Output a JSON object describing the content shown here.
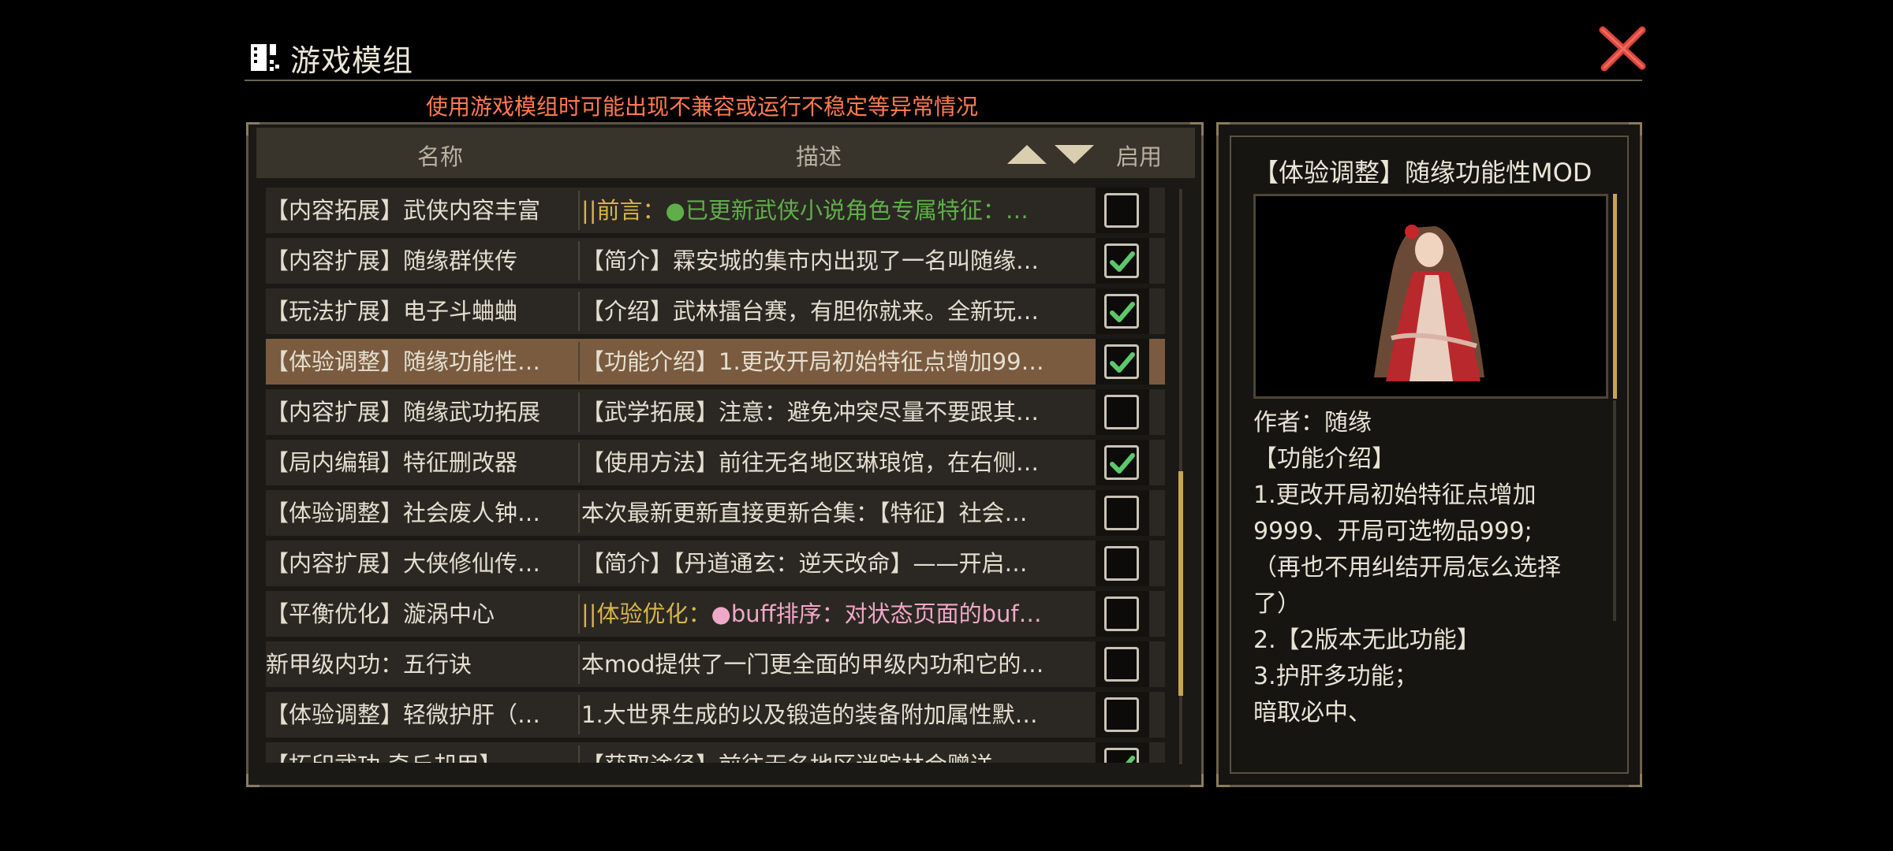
{
  "window": {
    "title": "游戏模组",
    "close_icon": "close-x-icon",
    "header_icon": "mod-grid-icon",
    "warning": "使用游戏模组时可能出现不兼容或运行不稳定等异常情况"
  },
  "table": {
    "columns": {
      "name": "名称",
      "desc": "描述",
      "enable": "启用"
    },
    "sort_icons": [
      "sort-up-icon",
      "sort-down-icon"
    ],
    "rows": [
      {
        "name": "【内容拓展】武侠内容丰富",
        "desc_prefix": "||前言：",
        "desc_prefix_color": "#d8b44a",
        "desc": "●已更新武侠小说角色专属特征：…",
        "desc_color": "#5fae4a",
        "checked": false,
        "selected": false
      },
      {
        "name": "【内容扩展】随缘群侠传",
        "desc_prefix": "",
        "desc": "【简介】霖安城的集市内出现了一名叫随缘…",
        "desc_color": "#e4ded0",
        "checked": true,
        "selected": false
      },
      {
        "name": "【玩法扩展】电子斗蛐蛐",
        "desc_prefix": "",
        "desc": "【介绍】武林擂台赛，有胆你就来。全新玩…",
        "desc_color": "#e4ded0",
        "checked": true,
        "selected": false
      },
      {
        "name": "【体验调整】随缘功能性…",
        "desc_prefix": "",
        "desc": "【功能介绍】1.更改开局初始特征点增加99…",
        "desc_color": "#e4ded0",
        "checked": true,
        "selected": true
      },
      {
        "name": "【内容扩展】随缘武功拓展",
        "desc_prefix": "",
        "desc": "【武学拓展】注意：避免冲突尽量不要跟其…",
        "desc_color": "#e4ded0",
        "checked": false,
        "selected": false
      },
      {
        "name": "【局内编辑】特征删改器",
        "desc_prefix": "",
        "desc": "【使用方法】前往无名地区琳琅馆，在右侧…",
        "desc_color": "#e4ded0",
        "checked": true,
        "selected": false
      },
      {
        "name": "【体验调整】社会废人钟…",
        "desc_prefix": "",
        "desc": "本次最新更新直接更新合集：【特征】社会…",
        "desc_color": "#e4ded0",
        "checked": false,
        "selected": false
      },
      {
        "name": "【内容扩展】大侠修仙传…",
        "desc_prefix": "",
        "desc": "【简介】【丹道通玄：逆天改命】——开启…",
        "desc_color": "#e4ded0",
        "checked": false,
        "selected": false
      },
      {
        "name": "【平衡优化】漩涡中心",
        "desc_prefix": "||体验优化：",
        "desc_prefix_color": "#d8b44a",
        "desc": "●buff排序：对状态页面的buf…",
        "desc_color": "#f0a8c8",
        "checked": false,
        "selected": false
      },
      {
        "name": "新甲级内功：五行诀",
        "desc_prefix": "",
        "desc": "本mod提供了一门更全面的甲级内功和它的…",
        "desc_color": "#e4ded0",
        "checked": false,
        "selected": false
      },
      {
        "name": "【体验调整】轻微护肝（…",
        "desc_prefix": "",
        "desc": "1.大世界生成的以及锻造的装备附加属性默…",
        "desc_color": "#e4ded0",
        "checked": false,
        "selected": false
      },
      {
        "name": "【拓印武功 奇丘却用】…",
        "desc_prefix": "",
        "desc": "【获取途径】前往无名地区迷踪林会赠送一…",
        "desc_color": "#e4ded0",
        "checked": true,
        "selected": false
      }
    ],
    "scroll_position": 0.7
  },
  "detail": {
    "title": "【体验调整】随缘功能性MOD",
    "image_icon": "character-portrait-red-robe",
    "lines": [
      "作者：随缘",
      "【功能介绍】",
      "1.更改开局初始特征点增加",
      "9999、开局可选物品999;",
      "（再也不用纠结开局怎么选择",
      "了）",
      "2.【2版本无此功能】",
      "3.护肝多功能；",
      "暗取必中、"
    ]
  },
  "colors": {
    "accent_gold": "#c8a54a",
    "warning": "#ff7a50",
    "check_green": "#5cc86a",
    "selected_row": "#7a5b3f"
  }
}
